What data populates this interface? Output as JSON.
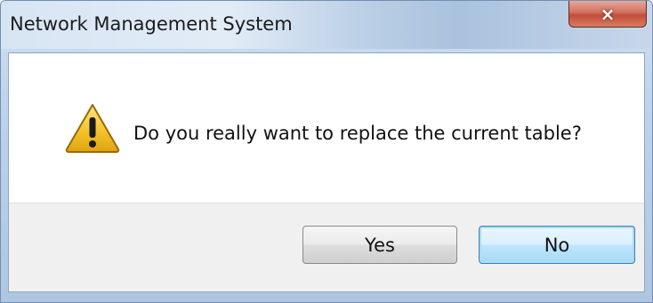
{
  "window": {
    "title": "Network Management System",
    "close_symbol": "×"
  },
  "dialog": {
    "icon": "warning-icon",
    "message": "Do you really want to replace the current table?"
  },
  "buttons": {
    "yes_label": "Yes",
    "no_label": "No",
    "default": "No"
  },
  "colors": {
    "warning_yellow": "#f4c42c",
    "close_red": "#c24d38",
    "default_button_blue": "#3c7fb1"
  }
}
